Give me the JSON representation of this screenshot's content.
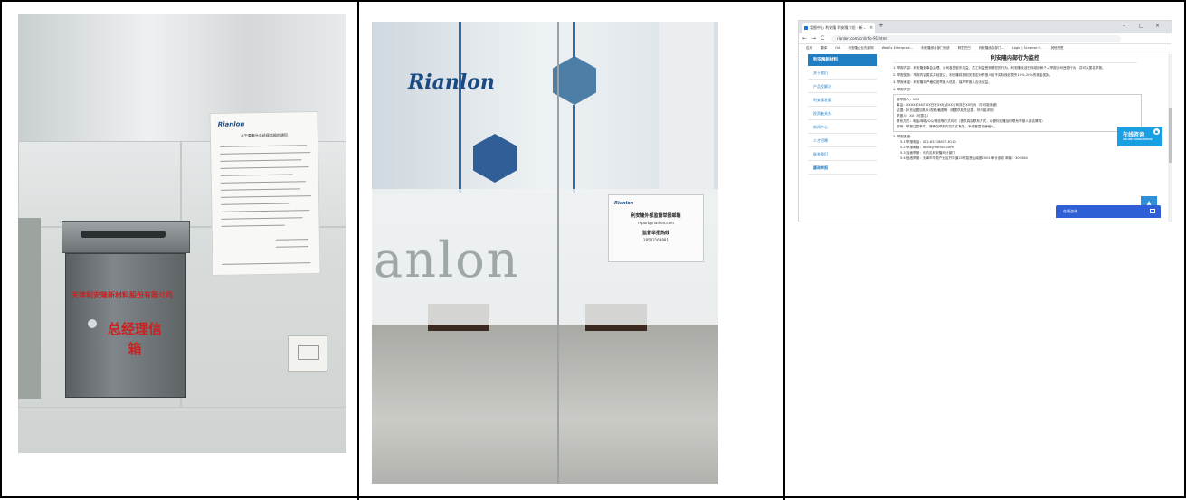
{
  "photo_mailbox": {
    "mailbox_company": "天津利安隆新材料股份有限公司",
    "mailbox_title": "总经理信箱",
    "notice_logo": "Rianlon",
    "notice_title": "关于董事长总经理信箱的通知"
  },
  "photo_door": {
    "wall_logo": "Rianlon",
    "glass_text": "anlon",
    "sign_logo": "Rianlon",
    "sign_title": "利安隆外部监督举报邮箱",
    "sign_email": "report@rianlon.com",
    "sign_hotline_label": "监督举报热线",
    "sign_phone": "18502164881"
  },
  "browser": {
    "tab_title": "看图中心 利安隆 利安隆介绍 - 新...",
    "tab_close": "×",
    "new_tab": "+",
    "win_min": "–",
    "win_max": "□",
    "win_close": "×",
    "back": "←",
    "forward": "→",
    "reload": "C",
    "url": "rianlon.com/cn/info-91.html",
    "bookmarks": [
      "应用",
      "翻译",
      "OA",
      "利安隆企业内部网",
      "WebEx Enterprise...",
      "利安隆综合部门系统",
      "阿里巴巴",
      "利安隆综合部门...",
      "Login | Sciverse P...",
      "其他书签"
    ],
    "sidebar_title": "利安隆新材料",
    "sidebar_items": [
      "关于我们",
      "产品及解决",
      "利安隆发展",
      "投资者关系",
      "新闻中心",
      "人才招聘",
      "联系我们",
      "廉政举报"
    ],
    "page_title": "利安隆内部行为监控",
    "paragraphs": [
      "1. 举报内容：利安隆董事会治理、公司各类股东权益、员工利益受到侵犯的行为，利安隆欢迎任何组织和个人举报公司违规行为，并可以匿名举报。",
      "2. 举报奖励：举报内容属实并经查实，利安隆将按相关规定对举报人给予实际挽回损失10%-20%的现金奖励。",
      "3. 举报承诺：利安隆将严格保密举报人信息，保护举报人合法权益。",
      "4. 举报内容："
    ],
    "form_lines": [
      "被举报人：XXX",
      "事由：XXXX年XX月XX日在XX地点XX公司存在XX行为（尽可能详细）",
      "证据：补充证据如照片/视频/截图等（请提供相关证据，尽可能详细）",
      "举报人：XX（可匿名）",
      "联系方式：电话/邮箱/QQ/微信等方式均可（提供真实联系方式，以便利安隆及时联系举报人核实情况）",
      "说明：举报注意事项，请确保举报内容真实有效，不得恶意诽谤他人。"
    ],
    "after_lines": [
      "5. 举报渠道：",
      "5.1 举报电话：022-83718817-8110",
      "5.2 举报邮箱：audit@rianlon.com",
      "5.3 当面举报：可约见利安隆审计部门",
      "5.4 信函举报：天津市华苑产业区开华道20号智慧山南座2002 审计部收 邮编：300384"
    ],
    "consult_label": "在线咨询",
    "consult_sub": "ONLINE CONSULTATION",
    "totop": "▲",
    "chat_label": "在线咨询"
  }
}
